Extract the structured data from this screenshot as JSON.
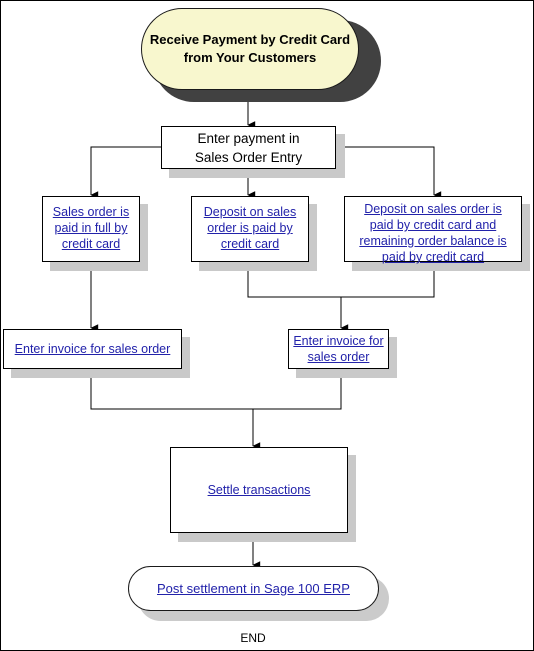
{
  "diagram": {
    "title": "Receive Payment by Credit Card flow",
    "colors": {
      "link_blue": "#2222aa",
      "start_fill": "#f8f7ce",
      "start_shadow": "#414141",
      "box_shadow": "#c9c9c9",
      "border": "#000000",
      "background": "#ffffff"
    }
  },
  "nodes": {
    "start": {
      "line1": "Receive Payment by Credit Card",
      "line2": "from Your Customers"
    },
    "enter_payment": {
      "line1": "Enter payment in",
      "line2": "Sales Order Entry"
    },
    "branch1": {
      "line1": "Sales order is",
      "line2": "paid in full by",
      "line3": "credit card"
    },
    "branch2": {
      "line1": "Deposit on sales",
      "line2": "order is paid by",
      "line3": "credit card"
    },
    "branch3": {
      "line1": "Deposit on sales order is",
      "line2": "paid by credit card and",
      "line3": "remaining order balance is",
      "line4": "paid by credit card"
    },
    "invoice_left": {
      "line1": "Enter invoice for sales order"
    },
    "invoice_right": {
      "line1": "Enter invoice for",
      "line2": "sales order"
    },
    "settle": {
      "line1": "Settle transactions"
    },
    "post": {
      "line1": "Post settlement in Sage 100 ERP"
    },
    "end_label": "END"
  }
}
